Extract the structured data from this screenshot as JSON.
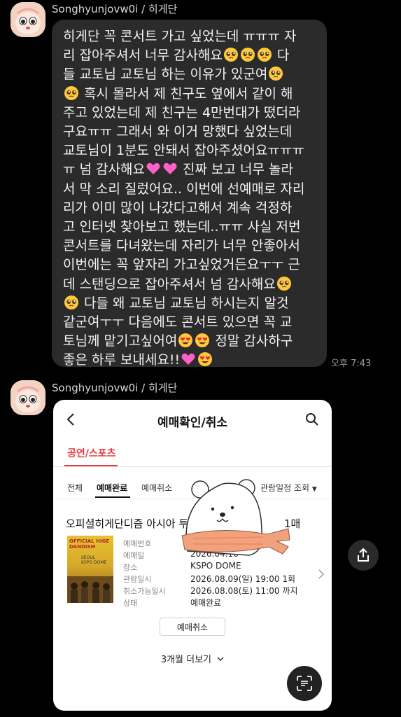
{
  "messages": [
    {
      "sender": "Songhyunjovw0i / 히게단",
      "text_lines": [
        [
          "히게단 꼭 콘서트 가고 싶었는데 ㅠㅠㅠ 자"
        ],
        [
          "리 잡아주셔서 너무 감사해요",
          "E:pleading",
          "E:pleading",
          "E:pleading",
          " 다"
        ],
        [
          "들 교토님 교토님 하는 이유가 있군여",
          "E:pleading"
        ],
        [
          "E:pleading",
          " 혹시 몰라서 제 친구도 옆에서 같이 해"
        ],
        [
          "주고 있었는데 제 친구는 4만번대가 떴더라"
        ],
        [
          "구요ㅠㅠ 그래서 와 이거 망했다 싶었는데"
        ],
        [
          "교토님이 1분도 안돼서 잡아주셨어요ㅠㅠㅠ"
        ],
        [
          "ㅠ 넘 감사해요",
          "E:heart",
          "E:heart",
          " 진짜 보고 너무 놀라"
        ],
        [
          "서 막 소리 질렀어요.. 이번에 선예매로 자리"
        ],
        [
          "리가 이미 많이 나갔다고해서 계속 걱정하"
        ],
        [
          "고 인터넷 찾아보고 했는데..ㅠㅠ 사실 저번"
        ],
        [
          "콘서트를 다녀왔는데 자리가 너무 안좋아서"
        ],
        [
          "이번에는 꼭 앞자리 가고싶었거든요ㅜㅜ 근"
        ],
        [
          "데 스탠딩으로 잡아주셔서 넘 감사해요",
          "E:pleading"
        ],
        [
          "E:pleading",
          " 다들 왜 교토님 교토님 하시는지 알것"
        ],
        [
          "같군여ㅜㅜ 다음에도 콘서트 있으면 꼭 교"
        ],
        [
          "토님께 맡기고싶어여",
          "E:hearteyes",
          "E:hearteyes",
          " 정말 감사하구"
        ],
        [
          "좋은 하루 보내세요!!",
          "E:heart",
          "E:hearteyes"
        ]
      ],
      "time": "오후 7:43"
    },
    {
      "sender": "Songhyunjovw0i / 히게단"
    }
  ],
  "booking_screenshot": {
    "header_title": "예매확인/취소",
    "category_tab": "공연/스포츠",
    "filters": [
      "전체",
      "예매완료",
      "예매취소"
    ],
    "active_filter": "예매완료",
    "view_schedule": "관람일정 조회",
    "show_title": "오피셜히게단디즘 아시아 투",
    "quantity": "1매",
    "poster_text_top": "OFFICIAL HIGE DANDISM",
    "poster_text_mid": "SEOUL\nKSPO DOME",
    "details": [
      {
        "label": "예매번호",
        "value": ""
      },
      {
        "label": "예매일",
        "value": "2026.04.16"
      },
      {
        "label": "장소",
        "value": "KSPO DOME"
      },
      {
        "label": "관람일시",
        "value": "2026.08.09(일) 19:00 1회"
      },
      {
        "label": "취소가능일시",
        "value": "2026.08.08(토) 11:00 까지"
      },
      {
        "label": "상태",
        "value": "예매완료"
      }
    ],
    "cancel_button": "예매취소",
    "more_label": "3개월 더보기"
  },
  "icons": {
    "back": "chevron-left-icon",
    "search": "search-icon",
    "scan": "scan-icon",
    "share": "share-icon",
    "sticker": "bear-sticker"
  },
  "colors": {
    "background": "#000000",
    "bubble": "#2b2b2b",
    "accent_red": "#e8383d"
  }
}
